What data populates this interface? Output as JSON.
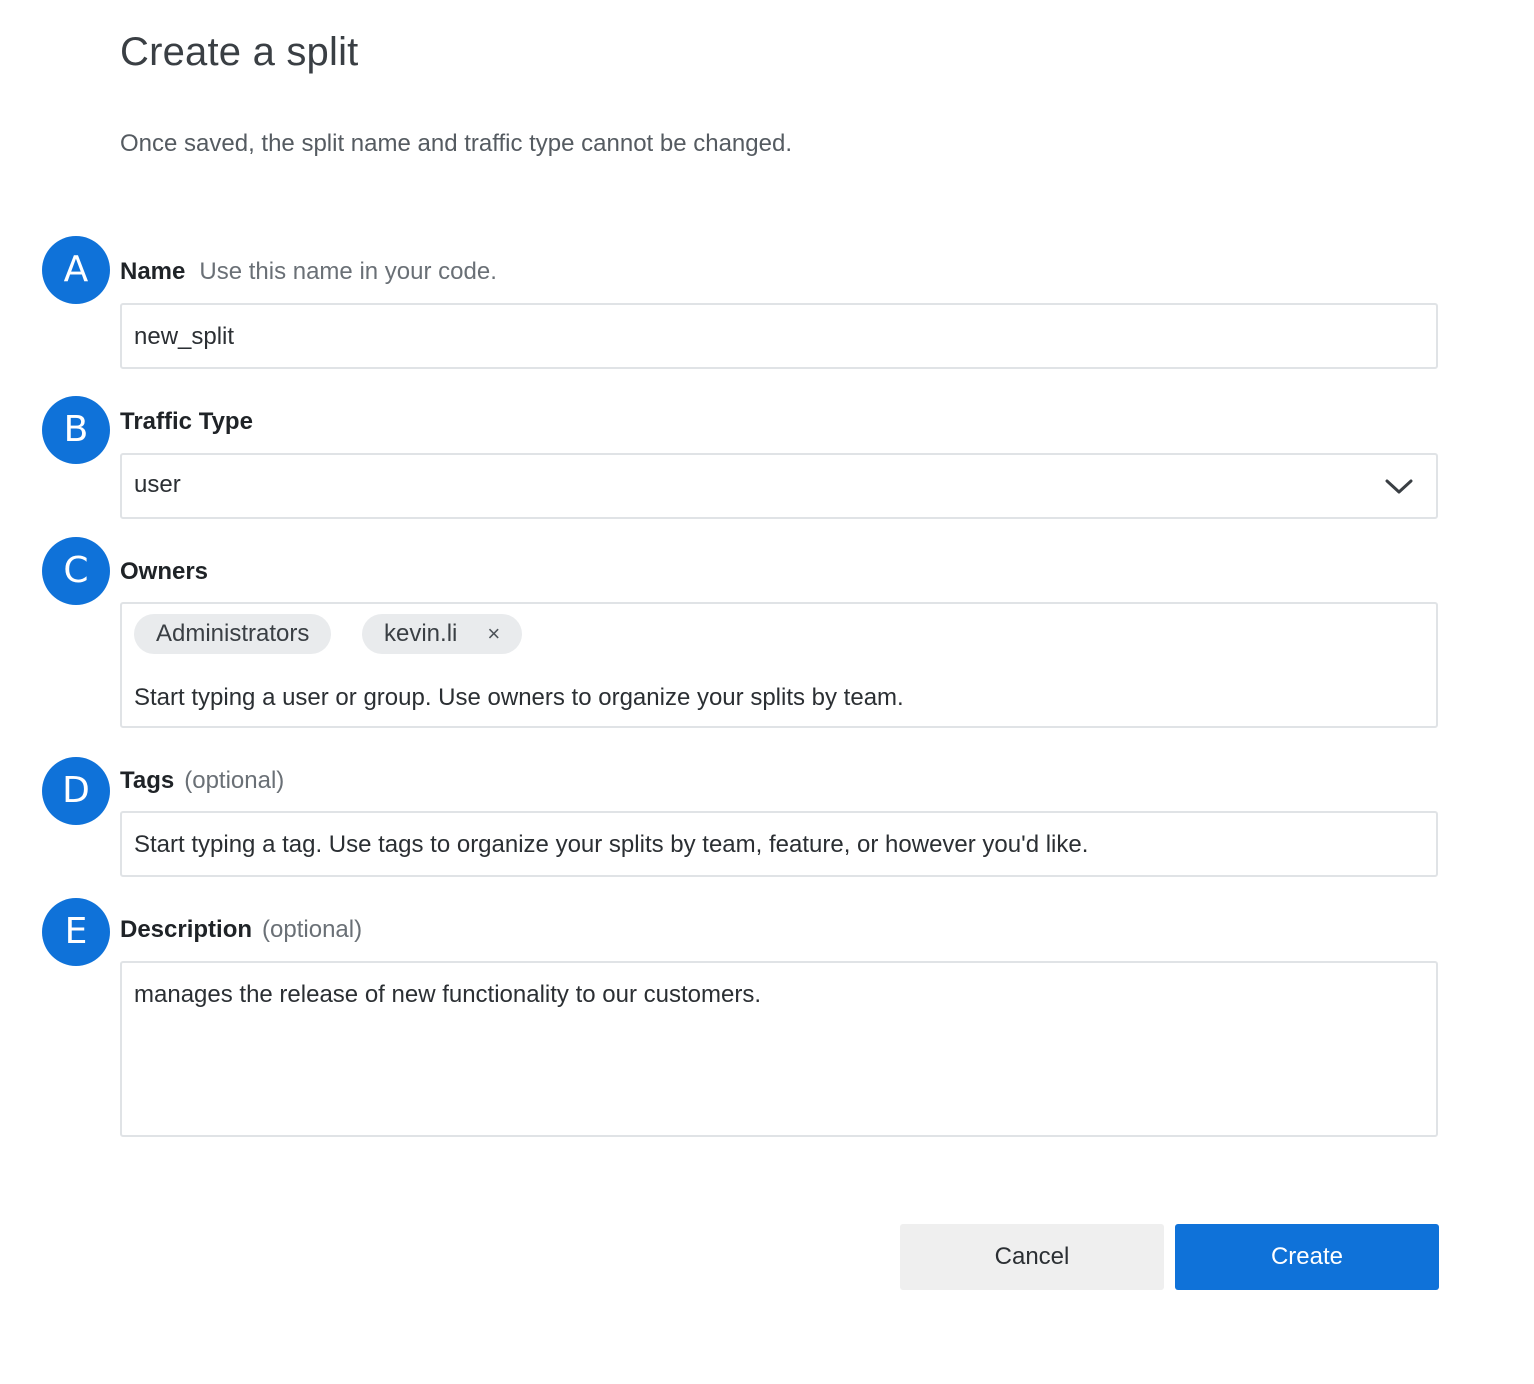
{
  "header": {
    "title": "Create a split",
    "subtitle": "Once saved, the split name and traffic type cannot be changed."
  },
  "fields": {
    "name": {
      "marker": "A",
      "label": "Name",
      "hint": "Use this name in your code.",
      "value": "new_split"
    },
    "traffic_type": {
      "marker": "B",
      "label": "Traffic Type",
      "value": "user",
      "icon": "chevron-down-icon"
    },
    "owners": {
      "marker": "C",
      "label": "Owners",
      "chips": [
        "Administrators",
        "kevin.li"
      ],
      "chip_remove_glyph": "×",
      "placeholder": "Start typing a user or group. Use owners to organize your splits by team."
    },
    "tags": {
      "marker": "D",
      "label": "Tags",
      "hint": "(optional)",
      "placeholder": "Start typing a tag. Use tags to organize your splits by team, feature, or however you'd like."
    },
    "description": {
      "marker": "E",
      "label": "Description",
      "hint": "(optional)",
      "value": "manages the release of new functionality to our customers."
    }
  },
  "actions": {
    "cancel_label": "Cancel",
    "create_label": "Create"
  },
  "colors": {
    "accent": "#0f72d9",
    "border": "#e0e3e6",
    "chip_bg": "#e9ebed",
    "cancel_bg": "#efefef"
  }
}
